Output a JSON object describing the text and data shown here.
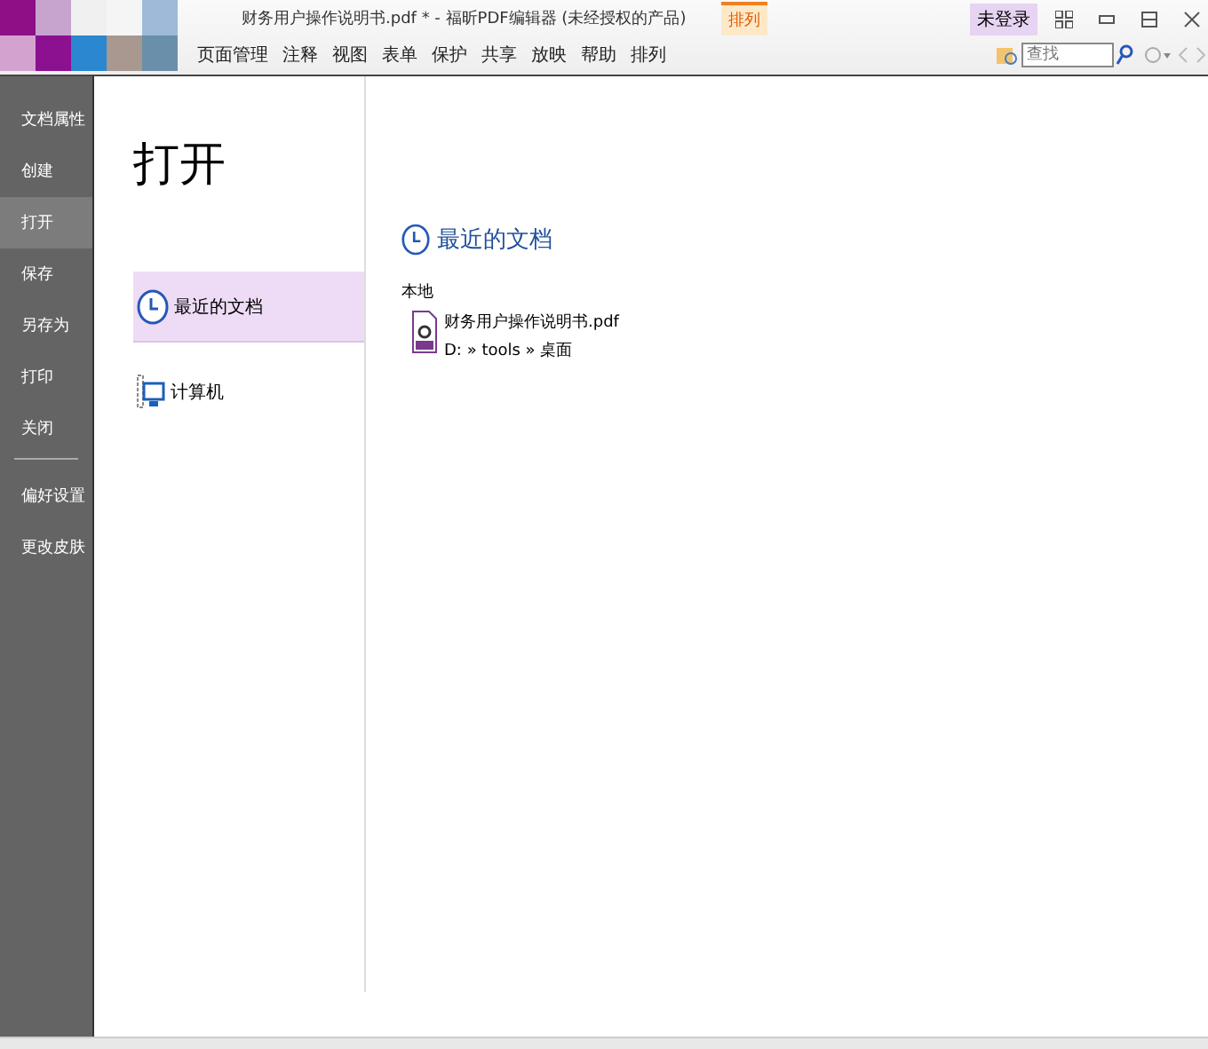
{
  "window": {
    "title": "财务用户操作说明书.pdf * - 福昕PDF编辑器 (未经授权的产品)",
    "context_tab": "排列",
    "login": "未登录"
  },
  "ribbon_tabs": [
    {
      "label": "页面管理",
      "selected": false
    },
    {
      "label": "注释",
      "selected": false
    },
    {
      "label": "视图",
      "selected": false
    },
    {
      "label": "表单",
      "selected": false
    },
    {
      "label": "保护",
      "selected": false
    },
    {
      "label": "共享",
      "selected": false
    },
    {
      "label": "放映",
      "selected": false
    },
    {
      "label": "帮助",
      "selected": false
    },
    {
      "label": "排列",
      "selected": false
    }
  ],
  "search": {
    "placeholder": "查找"
  },
  "sidebar": {
    "items": [
      {
        "label": "文档属性",
        "selected": false,
        "kind": "item"
      },
      {
        "label": "创建",
        "selected": false,
        "kind": "item"
      },
      {
        "label": "打开",
        "selected": true,
        "kind": "item"
      },
      {
        "label": "保存",
        "selected": false,
        "kind": "item"
      },
      {
        "label": "另存为",
        "selected": false,
        "kind": "item"
      },
      {
        "label": "打印",
        "selected": false,
        "kind": "item"
      },
      {
        "label": "关闭",
        "selected": false,
        "kind": "item"
      },
      {
        "kind": "divider"
      },
      {
        "label": "偏好设置",
        "selected": false,
        "kind": "item"
      },
      {
        "label": "更改皮肤",
        "selected": false,
        "kind": "item"
      }
    ]
  },
  "page_title": "打开",
  "places": [
    {
      "label": "最近的文档",
      "selected": true,
      "kind": "recent"
    },
    {
      "label": "计算机",
      "selected": false,
      "kind": "computer"
    }
  ],
  "recent": {
    "heading": "最近的文档",
    "group": "本地",
    "files": [
      {
        "name": "财务用户操作说明书.pdf",
        "path": "D: » tools » 桌面"
      }
    ]
  }
}
